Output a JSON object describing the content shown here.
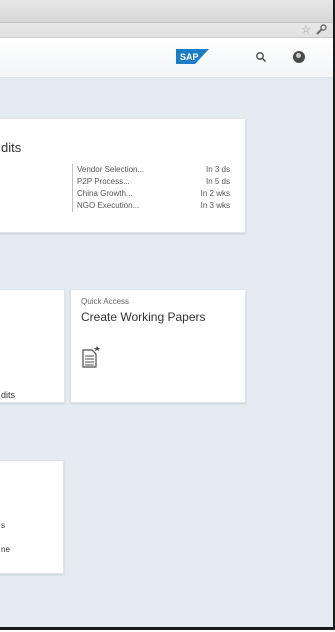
{
  "browser": {
    "icons": {
      "bookmark": "star-icon",
      "menu": "wrench-icon"
    }
  },
  "shell": {
    "logo_text": "SAP",
    "logo_color": "#1b7dc5",
    "icons": {
      "search": "search-icon",
      "user": "user-icon"
    }
  },
  "tiles": {
    "projects": {
      "title": "dits",
      "items": [
        {
          "project": "Vendor Selection...",
          "due": "In 3 ds"
        },
        {
          "project": "P2P Process...",
          "due": "In 5 ds"
        },
        {
          "project": "China Growth...",
          "due": "In 2 wks"
        },
        {
          "project": "NGO Execution...",
          "due": "In 3 wks"
        }
      ]
    },
    "partial_left": {
      "text": "dits"
    },
    "quick_access": {
      "subtitle": "Quick Access",
      "title": "Create Working Papers",
      "icon": "document-icon"
    },
    "partial_bottom": {
      "line1": "s",
      "line2": "ne"
    }
  }
}
